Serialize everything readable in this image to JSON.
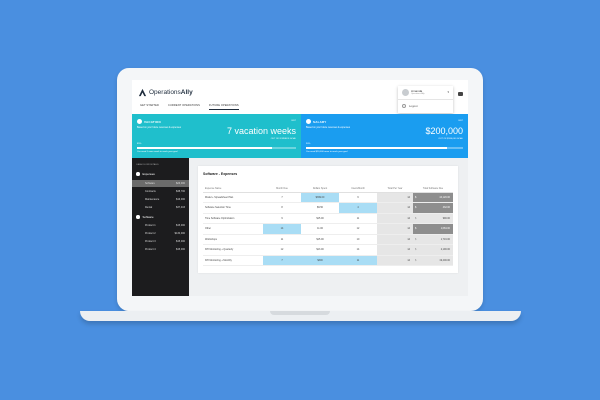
{
  "app": {
    "logo_prefix": "Operations",
    "logo_suffix": "Ally"
  },
  "tabs": [
    "GET STARTED",
    "CURRENT OPERATIONS",
    "FUTURE OPERATIONS"
  ],
  "user": {
    "name": "Amanda",
    "role": "Operations Ally",
    "logout": "Logout"
  },
  "vacation": {
    "title": "VACATION",
    "edit": "EDIT",
    "desc": "Based on your future revenues & expenses",
    "big": "7 vacation weeks",
    "sub": "OUT OF 8 WEEKS GOAL",
    "pct_label": "85%",
    "pct": 0.85,
    "foot": "You need 1 more week to reach your goal"
  },
  "salary": {
    "title": "SALARY",
    "edit": "EDIT",
    "desc": "Based on your future revenues & expenses",
    "big": "$200,000",
    "sub": "OUT OF $180,000 GOAL",
    "pct_label": "90%",
    "pct": 0.9,
    "foot": "You need $20,000 more to reach your goal"
  },
  "sidebar": {
    "header": "CASH FLOW DETAILS",
    "expenses_label": "Expenses",
    "expenses": [
      {
        "label": "Software",
        "value": "$26,000"
      },
      {
        "label": "Contracts",
        "value": "$38,700"
      },
      {
        "label": "Maintenance",
        "value": "$16,000"
      },
      {
        "label": "Rental",
        "value": "$37,403"
      }
    ],
    "software_label": "Software",
    "products": [
      {
        "label": "Product 1",
        "value": "$15,000"
      },
      {
        "label": "Product 2",
        "value": "$130,000"
      },
      {
        "label": "Product 3",
        "value": "$15,000"
      },
      {
        "label": "Product 4",
        "value": "$15,000"
      }
    ]
  },
  "table": {
    "title": "Software - Expenses",
    "headers": [
      "Expense Name",
      "Month Due",
      "Dollars Spent",
      "Users/Month",
      "Total Per Year",
      "Total Software Due"
    ],
    "rows": [
      {
        "name": "Model + Spreadsheet Plan",
        "month": "7",
        "dollars": "$399.00",
        "users": "6",
        "year": "14",
        "total": "44,120.00"
      },
      {
        "name": "Software Selection Time",
        "month": "8",
        "dollars": "$9.50",
        "users": "4",
        "year": "14",
        "total": "432.00"
      },
      {
        "name": "Time Software Optimization",
        "month": "9",
        "dollars": "$15.00",
        "users": "11",
        "year": "14",
        "total": "990.00"
      },
      {
        "name": "Other",
        "month": "14",
        "dollars": "11.00",
        "users": "12",
        "year": "14",
        "total": "1,684.00"
      },
      {
        "name": "Workshops",
        "month": "11",
        "dollars": "$15.00",
        "users": "10",
        "year": "14",
        "total": "1,716.00"
      },
      {
        "name": "KPI Monitoring + Quarterly",
        "month": "12",
        "dollars": "$13.00",
        "users": "14",
        "year": "14",
        "total": "2,190.00"
      },
      {
        "name": "KPI Monitoring + Monthly",
        "month": "7",
        "dollars": "$300",
        "users": "11",
        "year": "14",
        "total": "19,400.00"
      }
    ],
    "unit": "$"
  },
  "colors": {
    "vacation": "#1fbfcc",
    "salary": "#1a9df0",
    "highlight": "#a9ddf5",
    "background": "#4a8fe0"
  }
}
